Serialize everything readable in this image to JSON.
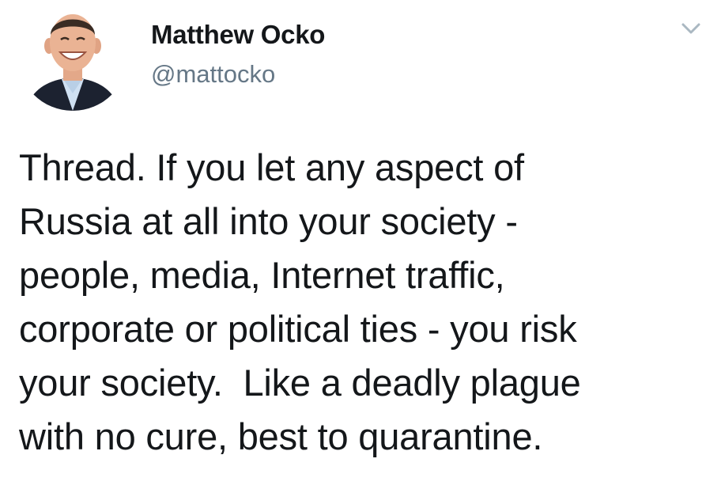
{
  "author": {
    "display_name": "Matthew Ocko",
    "handle": "@mattocko",
    "avatar_icon": "profile-photo"
  },
  "menu": {
    "icon": "chevron-down-icon"
  },
  "tweet": {
    "lines": [
      "Thread. If you let any aspect of",
      "Russia at all into your society -",
      "people, media, Internet traffic,",
      "corporate or political ties - you risk",
      "your society.  Like a deadly plague",
      "with no cure, best to quarantine."
    ]
  },
  "colors": {
    "text": "#14171a",
    "secondary": "#657786",
    "chevron": "#aab8c2"
  }
}
